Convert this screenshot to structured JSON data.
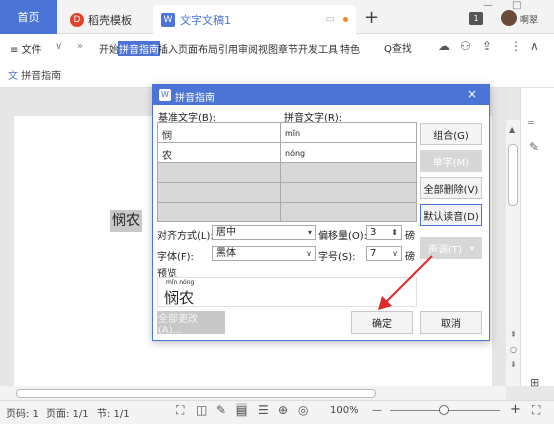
{
  "tabs": {
    "home": "首页",
    "template": "稻壳模板",
    "document": "文字文稿1",
    "add": "+"
  },
  "window": {
    "badge": "1",
    "username": "啊翠",
    "minimize": "—",
    "restore": "□"
  },
  "menu": {
    "file": "≡ 文件",
    "items": [
      "开始",
      "拼音指南",
      "插入",
      "页面布局",
      "引用",
      "审阅",
      "视图",
      "章节",
      "开发工具",
      "特色"
    ],
    "search": "Q查找"
  },
  "toolbar": {
    "pinyin_guide": "拼音指南"
  },
  "document": {
    "selected_text": "悯农"
  },
  "dialog": {
    "title": "拼音指南",
    "close": "×",
    "base_text_header": "基准文字(B):",
    "ruby_text_header": "拼音文字(R):",
    "rows": [
      {
        "base": "悯",
        "ruby": "mǐn"
      },
      {
        "base": "农",
        "ruby": "nóng"
      }
    ],
    "buttons": {
      "group": "组合(G)",
      "single": "单字(M)",
      "clear_all": "全部删除(V)",
      "default": "默认读音(D)",
      "tone": "声调(T)",
      "apply_all": "全部更改 (A)...",
      "ok": "确定",
      "cancel": "取消"
    },
    "alignment_label": "对齐方式(L):",
    "alignment_value": "居中",
    "offset_label": "偏移量(O):",
    "offset_value": "3",
    "offset_unit": "磅",
    "font_label": "字体(F):",
    "font_value": "黑体",
    "size_label": "字号(S):",
    "size_value": "7",
    "size_unit": "磅",
    "preview_label": "预览",
    "preview_pinyin": "mǐn nóng",
    "preview_text": "悯农"
  },
  "status": {
    "page_no": "页码: 1",
    "pages": "页面: 1/1",
    "section": "节: 1/1",
    "zoom": "100%",
    "zoom_minus": "—",
    "zoom_plus": "+"
  },
  "colors": {
    "accent": "#4b74d6",
    "arrow": "#e02a2a"
  }
}
